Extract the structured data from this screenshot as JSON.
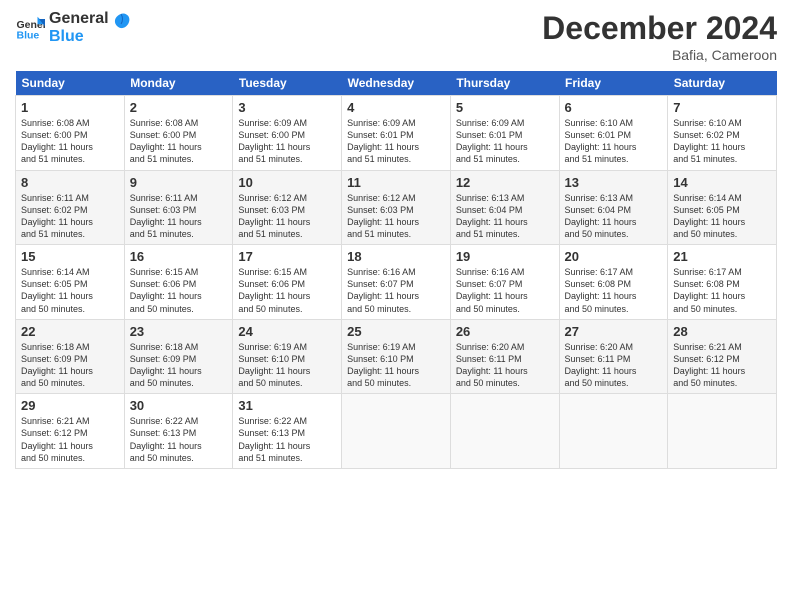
{
  "logo": {
    "line1": "General",
    "line2": "Blue"
  },
  "title": "December 2024",
  "location": "Bafia, Cameroon",
  "days_of_week": [
    "Sunday",
    "Monday",
    "Tuesday",
    "Wednesday",
    "Thursday",
    "Friday",
    "Saturday"
  ],
  "weeks": [
    [
      {
        "day": 1,
        "sunrise": "6:08 AM",
        "sunset": "6:00 PM",
        "daylight": "11 hours and 51 minutes"
      },
      {
        "day": 2,
        "sunrise": "6:08 AM",
        "sunset": "6:00 PM",
        "daylight": "11 hours and 51 minutes"
      },
      {
        "day": 3,
        "sunrise": "6:09 AM",
        "sunset": "6:00 PM",
        "daylight": "11 hours and 51 minutes"
      },
      {
        "day": 4,
        "sunrise": "6:09 AM",
        "sunset": "6:01 PM",
        "daylight": "11 hours and 51 minutes"
      },
      {
        "day": 5,
        "sunrise": "6:09 AM",
        "sunset": "6:01 PM",
        "daylight": "11 hours and 51 minutes"
      },
      {
        "day": 6,
        "sunrise": "6:10 AM",
        "sunset": "6:01 PM",
        "daylight": "11 hours and 51 minutes"
      },
      {
        "day": 7,
        "sunrise": "6:10 AM",
        "sunset": "6:02 PM",
        "daylight": "11 hours and 51 minutes"
      }
    ],
    [
      {
        "day": 8,
        "sunrise": "6:11 AM",
        "sunset": "6:02 PM",
        "daylight": "11 hours and 51 minutes"
      },
      {
        "day": 9,
        "sunrise": "6:11 AM",
        "sunset": "6:03 PM",
        "daylight": "11 hours and 51 minutes"
      },
      {
        "day": 10,
        "sunrise": "6:12 AM",
        "sunset": "6:03 PM",
        "daylight": "11 hours and 51 minutes"
      },
      {
        "day": 11,
        "sunrise": "6:12 AM",
        "sunset": "6:03 PM",
        "daylight": "11 hours and 51 minutes"
      },
      {
        "day": 12,
        "sunrise": "6:13 AM",
        "sunset": "6:04 PM",
        "daylight": "11 hours and 51 minutes"
      },
      {
        "day": 13,
        "sunrise": "6:13 AM",
        "sunset": "6:04 PM",
        "daylight": "11 hours and 50 minutes"
      },
      {
        "day": 14,
        "sunrise": "6:14 AM",
        "sunset": "6:05 PM",
        "daylight": "11 hours and 50 minutes"
      }
    ],
    [
      {
        "day": 15,
        "sunrise": "6:14 AM",
        "sunset": "6:05 PM",
        "daylight": "11 hours and 50 minutes"
      },
      {
        "day": 16,
        "sunrise": "6:15 AM",
        "sunset": "6:06 PM",
        "daylight": "11 hours and 50 minutes"
      },
      {
        "day": 17,
        "sunrise": "6:15 AM",
        "sunset": "6:06 PM",
        "daylight": "11 hours and 50 minutes"
      },
      {
        "day": 18,
        "sunrise": "6:16 AM",
        "sunset": "6:07 PM",
        "daylight": "11 hours and 50 minutes"
      },
      {
        "day": 19,
        "sunrise": "6:16 AM",
        "sunset": "6:07 PM",
        "daylight": "11 hours and 50 minutes"
      },
      {
        "day": 20,
        "sunrise": "6:17 AM",
        "sunset": "6:08 PM",
        "daylight": "11 hours and 50 minutes"
      },
      {
        "day": 21,
        "sunrise": "6:17 AM",
        "sunset": "6:08 PM",
        "daylight": "11 hours and 50 minutes"
      }
    ],
    [
      {
        "day": 22,
        "sunrise": "6:18 AM",
        "sunset": "6:09 PM",
        "daylight": "11 hours and 50 minutes"
      },
      {
        "day": 23,
        "sunrise": "6:18 AM",
        "sunset": "6:09 PM",
        "daylight": "11 hours and 50 minutes"
      },
      {
        "day": 24,
        "sunrise": "6:19 AM",
        "sunset": "6:10 PM",
        "daylight": "11 hours and 50 minutes"
      },
      {
        "day": 25,
        "sunrise": "6:19 AM",
        "sunset": "6:10 PM",
        "daylight": "11 hours and 50 minutes"
      },
      {
        "day": 26,
        "sunrise": "6:20 AM",
        "sunset": "6:11 PM",
        "daylight": "11 hours and 50 minutes"
      },
      {
        "day": 27,
        "sunrise": "6:20 AM",
        "sunset": "6:11 PM",
        "daylight": "11 hours and 50 minutes"
      },
      {
        "day": 28,
        "sunrise": "6:21 AM",
        "sunset": "6:12 PM",
        "daylight": "11 hours and 50 minutes"
      }
    ],
    [
      {
        "day": 29,
        "sunrise": "6:21 AM",
        "sunset": "6:12 PM",
        "daylight": "11 hours and 50 minutes"
      },
      {
        "day": 30,
        "sunrise": "6:22 AM",
        "sunset": "6:13 PM",
        "daylight": "11 hours and 50 minutes"
      },
      {
        "day": 31,
        "sunrise": "6:22 AM",
        "sunset": "6:13 PM",
        "daylight": "11 hours and 51 minutes"
      },
      null,
      null,
      null,
      null
    ]
  ]
}
